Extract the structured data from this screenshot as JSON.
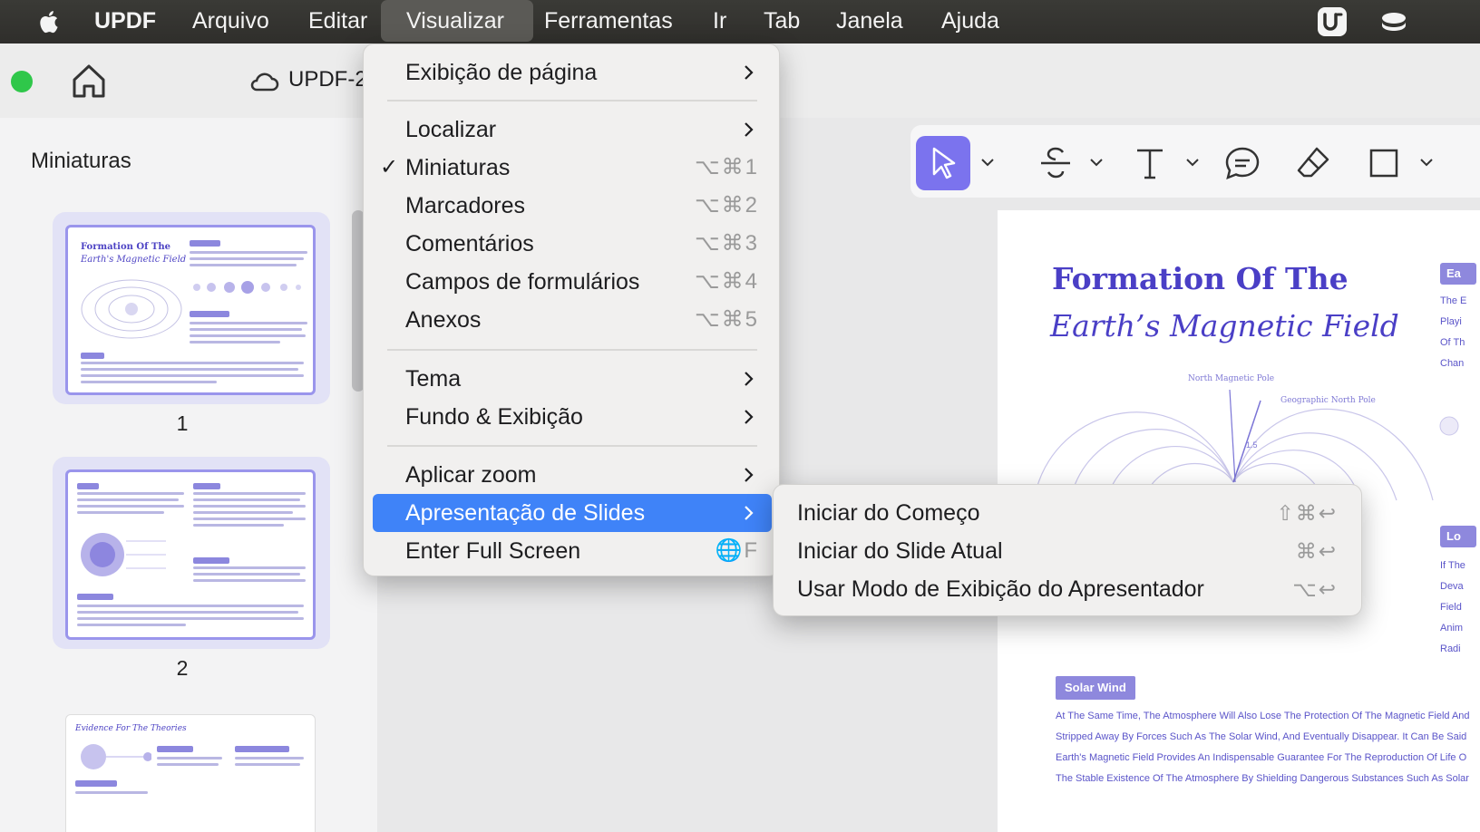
{
  "menubar": {
    "app_name": "UPDF",
    "items": [
      "Arquivo",
      "Editar",
      "Visualizar",
      "Ferramentas",
      "Ir",
      "Tab",
      "Janela",
      "Ajuda"
    ],
    "active": "Visualizar"
  },
  "window": {
    "doc_title": "UPDF-2("
  },
  "sidebar": {
    "title": "Miniaturas",
    "thumbnails": [
      {
        "number": "1",
        "title_line1": "Formation Of The",
        "title_line2": "Earth's Magnetic Field"
      },
      {
        "number": "2"
      },
      {
        "title": "Evidence For The Theories"
      }
    ]
  },
  "page": {
    "title_line1": "Formation Of The",
    "title_line2": "Earth’s Magnetic Field",
    "diagram_labels": {
      "north_magnetic": "North Magnetic Pole",
      "geographic_north": "Geographic North Pole",
      "angle": "1.5"
    },
    "solar_wind_tag": "Solar Wind",
    "paragraph": [
      "At The Same Time, The Atmosphere Will Also Lose The Protection Of The Magnetic Field And",
      "Stripped Away By Forces Such As The Solar Wind, And Eventually Disappear. It Can Be Said",
      "Earth's Magnetic Field Provides An Indispensable Guarantee For The Reproduction Of Life O",
      "The Stable Existence Of The Atmosphere By Shielding Dangerous Substances Such As Solar"
    ],
    "side_tag_1": "Ea",
    "side_tag_2": "Lo",
    "side_text_1": [
      "The E",
      "Playi",
      "Of Th",
      "Chan"
    ],
    "side_text_2": [
      "If The",
      "Deva",
      "Field",
      "Anim",
      "Radi"
    ]
  },
  "dropdown": {
    "items": [
      {
        "label": "Exibição de página",
        "submenu": true
      },
      {
        "label": "Localizar",
        "submenu": true
      },
      {
        "label": "Miniaturas",
        "shortcut": "⌥⌘1",
        "checked": true
      },
      {
        "label": "Marcadores",
        "shortcut": "⌥⌘2"
      },
      {
        "label": "Comentários",
        "shortcut": "⌥⌘3"
      },
      {
        "label": "Campos de formulários",
        "shortcut": "⌥⌘4"
      },
      {
        "label": "Anexos",
        "shortcut": "⌥⌘5"
      },
      {
        "label": "Tema",
        "submenu": true
      },
      {
        "label": "Fundo & Exibição",
        "submenu": true
      },
      {
        "label": "Aplicar zoom",
        "submenu": true
      },
      {
        "label": "Apresentação de Slides",
        "submenu": true,
        "highlighted": true
      },
      {
        "label": "Enter Full Screen",
        "shortcut": "🌐F"
      }
    ],
    "check_mark": "✓"
  },
  "submenu": {
    "items": [
      {
        "label": "Iniciar do Começo",
        "shortcut": "⇧⌘↩"
      },
      {
        "label": "Iniciar do Slide Atual",
        "shortcut": "⌘↩"
      },
      {
        "label": "Usar Modo de Exibição do Apresentador",
        "shortcut": "⌥↩"
      }
    ]
  },
  "colors": {
    "accent": "#7b73ee",
    "menu_highlight": "#3f83f8",
    "doc_purple": "#4a3fc6"
  }
}
